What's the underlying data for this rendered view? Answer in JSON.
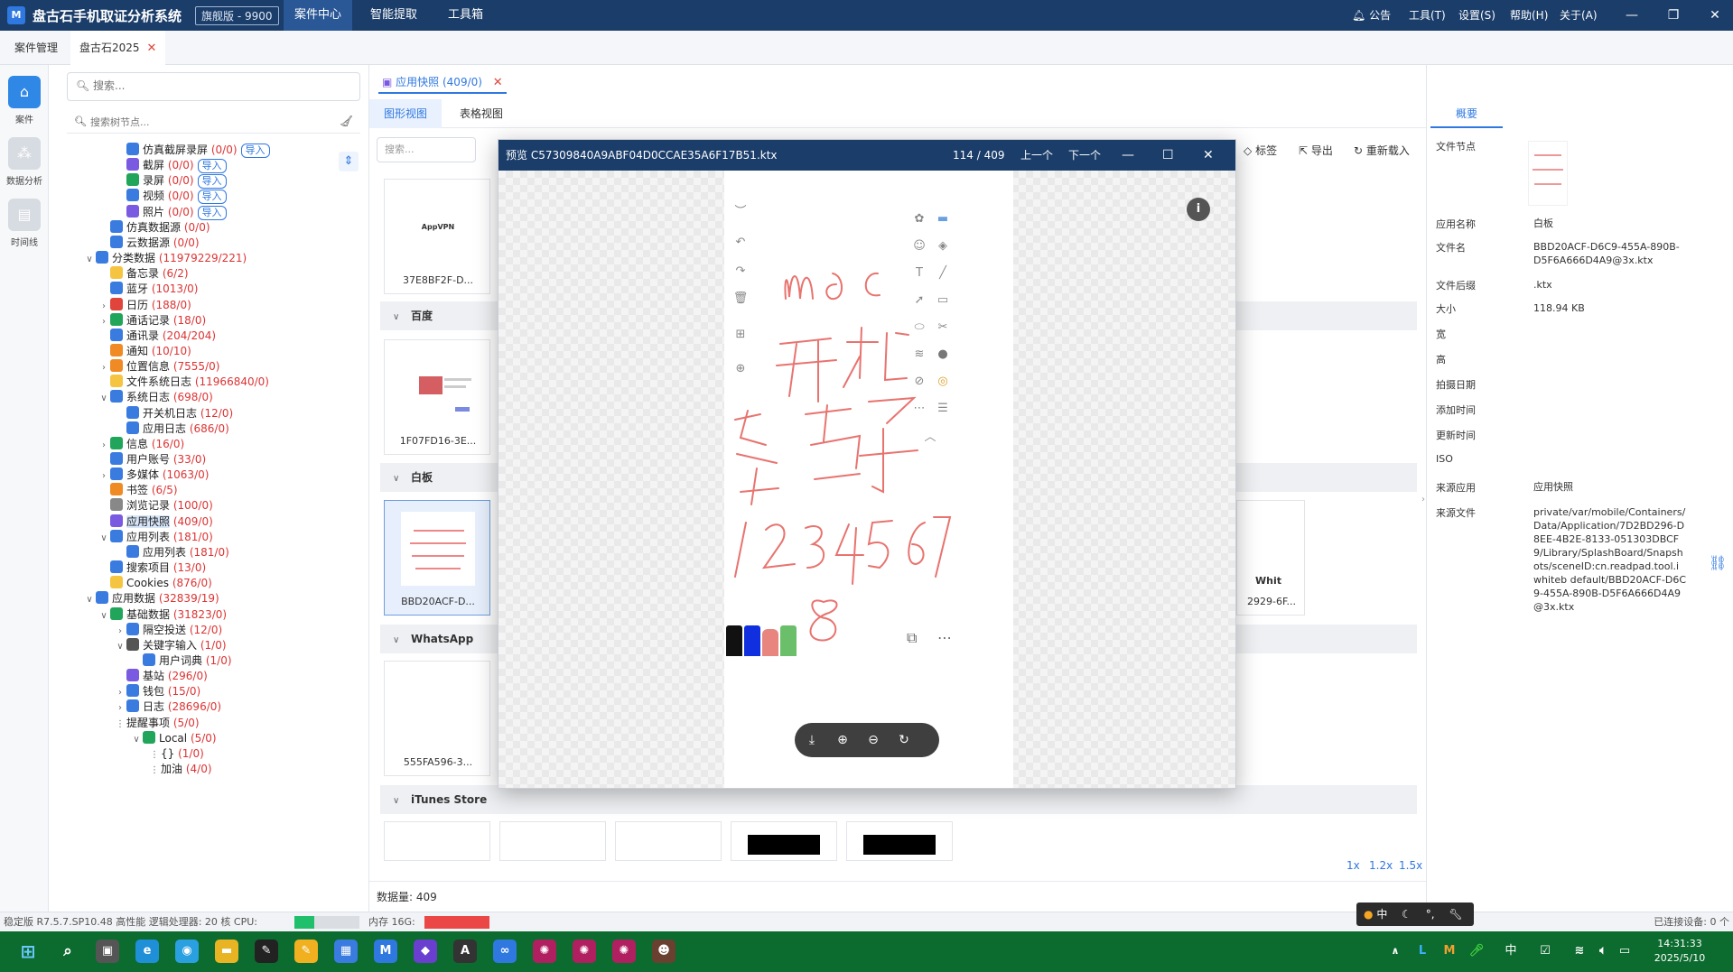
{
  "app": {
    "logo": "M",
    "name": "盘古石手机取证分析系统",
    "edition": "旗舰版 - 9900",
    "menus": [
      "案件中心",
      "智能提取",
      "工具箱"
    ],
    "right_menus": [
      "公告",
      "工具(T)",
      "设置(S)",
      "帮助(H)",
      "关于(A)"
    ]
  },
  "tabs": [
    "案件管理",
    "盘古石2025"
  ],
  "rail": [
    {
      "label": "案件",
      "icon": "home-icon"
    },
    {
      "label": "数据分析",
      "icon": "analysis-icon"
    },
    {
      "label": "时间线",
      "icon": "timeline-icon"
    }
  ],
  "sidebar": {
    "search_placeholder": "搜索...",
    "tree_search_placeholder": "搜索树节点...",
    "import_label": "导入",
    "tree": [
      {
        "label": "仿真截屏录屏",
        "cnt": "(0/0)",
        "lvl": 3,
        "arrow": "",
        "color": "#3a7be0",
        "imp": true
      },
      {
        "label": "截屏",
        "cnt": "(0/0)",
        "lvl": 3,
        "arrow": "",
        "color": "#7a5ae0",
        "imp": true
      },
      {
        "label": "录屏",
        "cnt": "(0/0)",
        "lvl": 3,
        "arrow": "",
        "color": "#21a55a",
        "imp": true
      },
      {
        "label": "视频",
        "cnt": "(0/0)",
        "lvl": 3,
        "arrow": "",
        "color": "#3a7be0",
        "imp": true
      },
      {
        "label": "照片",
        "cnt": "(0/0)",
        "lvl": 3,
        "arrow": "",
        "color": "#7a5ae0",
        "imp": true
      },
      {
        "label": "仿真数据源",
        "cnt": "(0/0)",
        "lvl": 2,
        "arrow": "",
        "color": "#3a7be0"
      },
      {
        "label": "云数据源",
        "cnt": "(0/0)",
        "lvl": 2,
        "arrow": "",
        "color": "#3a7be0"
      },
      {
        "label": "分类数据",
        "cnt": "(11979229/221)",
        "lvl": 1,
        "arrow": "v",
        "color": "#3a7be0"
      },
      {
        "label": "备忘录",
        "cnt": "(6/2)",
        "lvl": 2,
        "arrow": "",
        "color": "#f5c542"
      },
      {
        "label": "蓝牙",
        "cnt": "(1013/0)",
        "lvl": 2,
        "arrow": "",
        "color": "#3a7be0"
      },
      {
        "label": "日历",
        "cnt": "(188/0)",
        "lvl": 2,
        "arrow": ">",
        "color": "#e0443a"
      },
      {
        "label": "通话记录",
        "cnt": "(18/0)",
        "lvl": 2,
        "arrow": ">",
        "color": "#21a55a"
      },
      {
        "label": "通讯录",
        "cnt": "(204/204)",
        "lvl": 2,
        "arrow": "",
        "color": "#3a7be0"
      },
      {
        "label": "通知",
        "cnt": "(10/10)",
        "lvl": 2,
        "arrow": "",
        "color": "#f08a24"
      },
      {
        "label": "位置信息",
        "cnt": "(7555/0)",
        "lvl": 2,
        "arrow": ">",
        "color": "#f08a24"
      },
      {
        "label": "文件系统日志",
        "cnt": "(11966840/0)",
        "lvl": 2,
        "arrow": "",
        "color": "#f5c542"
      },
      {
        "label": "系统日志",
        "cnt": "(698/0)",
        "lvl": 2,
        "arrow": "v",
        "color": "#3a7be0"
      },
      {
        "label": "开关机日志",
        "cnt": "(12/0)",
        "lvl": 3,
        "arrow": "",
        "color": "#3a7be0"
      },
      {
        "label": "应用日志",
        "cnt": "(686/0)",
        "lvl": 3,
        "arrow": "",
        "color": "#3a7be0"
      },
      {
        "label": "信息",
        "cnt": "(16/0)",
        "lvl": 2,
        "arrow": ">",
        "color": "#21a55a"
      },
      {
        "label": "用户账号",
        "cnt": "(33/0)",
        "lvl": 2,
        "arrow": "",
        "color": "#3a7be0"
      },
      {
        "label": "多媒体",
        "cnt": "(1063/0)",
        "lvl": 2,
        "arrow": ">",
        "color": "#3a7be0"
      },
      {
        "label": "书签",
        "cnt": "(6/5)",
        "lvl": 2,
        "arrow": "",
        "color": "#f08a24"
      },
      {
        "label": "浏览记录",
        "cnt": "(100/0)",
        "lvl": 2,
        "arrow": "",
        "color": "#888888"
      },
      {
        "label": "应用快照",
        "cnt": "(409/0)",
        "lvl": 2,
        "arrow": "",
        "color": "#7a5ae0",
        "sel": true
      },
      {
        "label": "应用列表",
        "cnt": "(181/0)",
        "lvl": 2,
        "arrow": "v",
        "color": "#3a7be0"
      },
      {
        "label": "应用列表",
        "cnt": "(181/0)",
        "lvl": 3,
        "arrow": "",
        "color": "#3a7be0"
      },
      {
        "label": "搜索项目",
        "cnt": "(13/0)",
        "lvl": 2,
        "arrow": "",
        "color": "#3a7be0"
      },
      {
        "label": "Cookies",
        "cnt": "(876/0)",
        "lvl": 2,
        "arrow": "",
        "color": "#f5c542"
      },
      {
        "label": "应用数据",
        "cnt": "(32839/19)",
        "lvl": 1,
        "arrow": "v",
        "color": "#3a7be0"
      },
      {
        "label": "基础数据",
        "cnt": "(31823/0)",
        "lvl": 2,
        "arrow": "v",
        "color": "#21a55a"
      },
      {
        "label": "隔空投送",
        "cnt": "(12/0)",
        "lvl": 3,
        "arrow": ">",
        "color": "#3a7be0"
      },
      {
        "label": "关键字输入",
        "cnt": "(1/0)",
        "lvl": 3,
        "arrow": "v",
        "color": "#555555"
      },
      {
        "label": "用户词典",
        "cnt": "(1/0)",
        "lvl": 4,
        "arrow": "",
        "color": "#3a7be0"
      },
      {
        "label": "基站",
        "cnt": "(296/0)",
        "lvl": 3,
        "arrow": "",
        "color": "#7a5ae0"
      },
      {
        "label": "钱包",
        "cnt": "(15/0)",
        "lvl": 3,
        "arrow": ">",
        "color": "#3a7be0"
      },
      {
        "label": "日志",
        "cnt": "(28696/0)",
        "lvl": 3,
        "arrow": ">",
        "color": "#3a7be0"
      },
      {
        "label": "提醒事项",
        "cnt": "(5/0)",
        "lvl": 3,
        "arrow": "⋮",
        "color": ""
      },
      {
        "label": "Local",
        "cnt": "(5/0)",
        "lvl": 4,
        "arrow": "v",
        "color": "#21a55a"
      },
      {
        "label": "{}",
        "cnt": "(1/0)",
        "lvl": 5,
        "arrow": "⋮",
        "color": ""
      },
      {
        "label": "加油",
        "cnt": "(4/0)",
        "lvl": 5,
        "arrow": "⋮",
        "color": ""
      }
    ]
  },
  "main": {
    "panel_tab": "应用快照 (409/0)",
    "view_tabs": [
      "图形视图",
      "表格视图"
    ],
    "filter_placeholder": "搜索...",
    "toolbar": [
      "标签",
      "导出",
      "重新载入"
    ],
    "groups": [
      {
        "name": "百度",
        "cards": [
          {
            "cap": "1F07FD16-3E..."
          }
        ]
      },
      {
        "name": "白板",
        "cards": [
          {
            "cap": "BBD20ACF-D..."
          }
        ]
      },
      {
        "name": "WhatsApp",
        "cards": [
          {
            "cap": "555FA596-3..."
          }
        ]
      },
      {
        "name": "iTunes Store",
        "cards": []
      }
    ],
    "top_card_cap": "37E8BF2F-D...",
    "top_card_text": "AppVPN",
    "hidden_card_cap": "2929-6F...",
    "hidden_card_text": "Whit",
    "count_label": "数据量: 409",
    "zoom_links": [
      "1x",
      "1.2x",
      "1.5x"
    ]
  },
  "preview": {
    "title": "预览 C57309840A9ABF04D0CCAE35A6F17B51.ktx",
    "page": "114 / 409",
    "prev": "上一个",
    "next": "下一个",
    "info": "i",
    "handwriting": "mac 开机 密码 12345678"
  },
  "right_panel": {
    "tab": "概要",
    "rows": [
      {
        "k": "文件节点",
        "v": ""
      },
      {
        "k": "应用名称",
        "v": "白板"
      },
      {
        "k": "文件名",
        "v": "BBD20ACF-D6C9-455A-890B-D5F6A666D4A9@3x.ktx"
      },
      {
        "k": "文件后缀",
        "v": ".ktx"
      },
      {
        "k": "大小",
        "v": "118.94 KB"
      },
      {
        "k": "宽",
        "v": ""
      },
      {
        "k": "高",
        "v": ""
      },
      {
        "k": "拍摄日期",
        "v": ""
      },
      {
        "k": "添加时间",
        "v": ""
      },
      {
        "k": "更新时间",
        "v": ""
      },
      {
        "k": "ISO",
        "v": ""
      },
      {
        "k": "来源应用",
        "v": "应用快照"
      },
      {
        "k": "来源文件",
        "v": "private/var/mobile/Containers/Data/Application/7D2BD296-D8EE-4B2E-8133-051303DBCF9/Library/SplashBoard/Snapshots/sceneID:cn.readpad.tool.iwhiteb default/BBD20ACF-D6C9-455A-890B-D5F6A666D4A9@3x.ktx"
      }
    ]
  },
  "statusbar": {
    "left": "稳定版 R7.5.7.SP10.48  高性能  逻辑处理器: 20 核  CPU:",
    "mem": "内存 16G:",
    "right": "已连接设备: 0 个",
    "cpu_level": 0.3,
    "mem_level": 1.0,
    "cpu_color": "#1fbf6b",
    "mem_color": "#ec4747"
  },
  "ime": {
    "label": "中"
  },
  "taskbar": {
    "time": "14:31:33",
    "date": "2025/5/10",
    "tray": [
      "中"
    ]
  },
  "colors": {
    "accent": "#2f78e0",
    "titlebar": "#1b3d6a",
    "taskbar": "#0c6b2e",
    "count_red": "#dd3333"
  }
}
